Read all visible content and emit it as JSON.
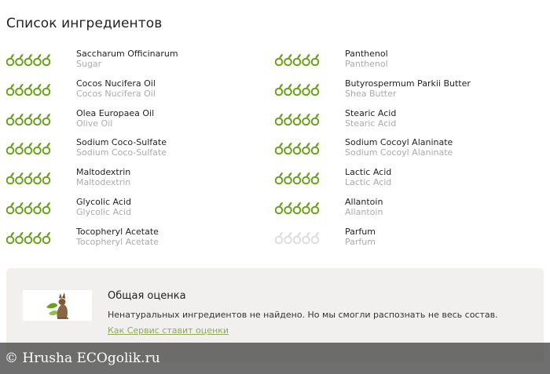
{
  "title": "Список ингредиентов",
  "colors": {
    "good": "#6aa01e",
    "unknown": "#dddddd",
    "link": "#8cab55"
  },
  "ingredients": [
    {
      "name": "Saccharum Officinarum",
      "common": "Sugar",
      "rating": 5,
      "status": "good"
    },
    {
      "name": "Cocos Nucifera Oil",
      "common": "Cocos Nucifera Oil",
      "rating": 5,
      "status": "good"
    },
    {
      "name": "Olea Europaea Oil",
      "common": "Olive Oil",
      "rating": 5,
      "status": "good"
    },
    {
      "name": "Sodium Coco-Sulfate",
      "common": "Sodium Coco-Sulfate",
      "rating": 5,
      "status": "good"
    },
    {
      "name": "Maltodextrin",
      "common": "Maltodextrin",
      "rating": 5,
      "status": "good"
    },
    {
      "name": "Glycolic Acid",
      "common": "Glycolic Acid",
      "rating": 5,
      "status": "good"
    },
    {
      "name": "Tocopheryl Acetate",
      "common": "Tocopheryl Acetate",
      "rating": 5,
      "status": "good"
    },
    {
      "name": "Panthenol",
      "common": "Panthenol",
      "rating": 5,
      "status": "good"
    },
    {
      "name": "Butyrospermum Parkii Butter",
      "common": "Shea Butter",
      "rating": 5,
      "status": "good"
    },
    {
      "name": "Stearic Acid",
      "common": "Stearic Acid",
      "rating": 5,
      "status": "good"
    },
    {
      "name": "Sodium Cocoyl Alaninate",
      "common": "Sodium Cocoyl Alaninate",
      "rating": 5,
      "status": "good"
    },
    {
      "name": "Lactic Acid",
      "common": "Lactic Acid",
      "rating": 5,
      "status": "good"
    },
    {
      "name": "Allantoin",
      "common": "Allantoin",
      "rating": 5,
      "status": "good"
    },
    {
      "name": "Parfum",
      "common": "Parfum",
      "rating": 5,
      "status": "unknown"
    }
  ],
  "summary": {
    "title": "Общая оценка",
    "text": "Ненатуральных ингредиентов не найдено. Но мы смогли распознать не весь состав.",
    "link": "Как Сервис ставит оценки",
    "logo_icon": "rabbit-icon"
  },
  "watermark": "© Hrusha ECOgolik.ru",
  "icons": {
    "rating": "leaf-drop-icon"
  }
}
